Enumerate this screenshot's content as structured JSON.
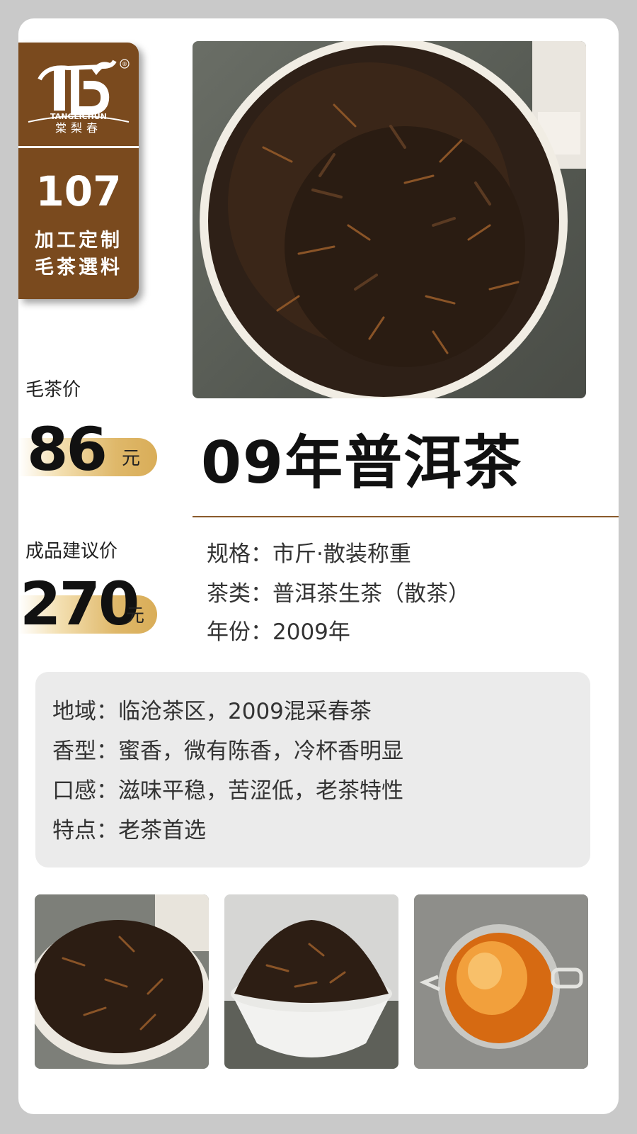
{
  "brand": {
    "logo_en": "TANGLICHUN",
    "logo_cn": "棠梨春",
    "registered_mark": "®",
    "number": "107",
    "line1": "加工定制",
    "line2": "毛茶選料"
  },
  "pricing": {
    "raw_label": "毛茶价",
    "raw_value": "86",
    "raw_unit": "元",
    "retail_label": "成品建议价",
    "retail_value": "270",
    "retail_unit": "元"
  },
  "product": {
    "title": "09年普洱茶"
  },
  "specs": [
    "规格：市斤·散装称重",
    "茶类：普洱茶生茶（散茶）",
    "年份：2009年"
  ],
  "details": [
    "地域：临沧茶区，2009混采春茶",
    "香型：蜜香，微有陈香，冷杯香明显",
    "口感：滋味平稳，苦涩低，老茶特性",
    "特点：老茶首选"
  ],
  "colors": {
    "brand_brown": "#7a4a1e",
    "gold": "#d9ad58",
    "card_bg": "#ffffff",
    "page_bg": "#c9c9c9"
  }
}
